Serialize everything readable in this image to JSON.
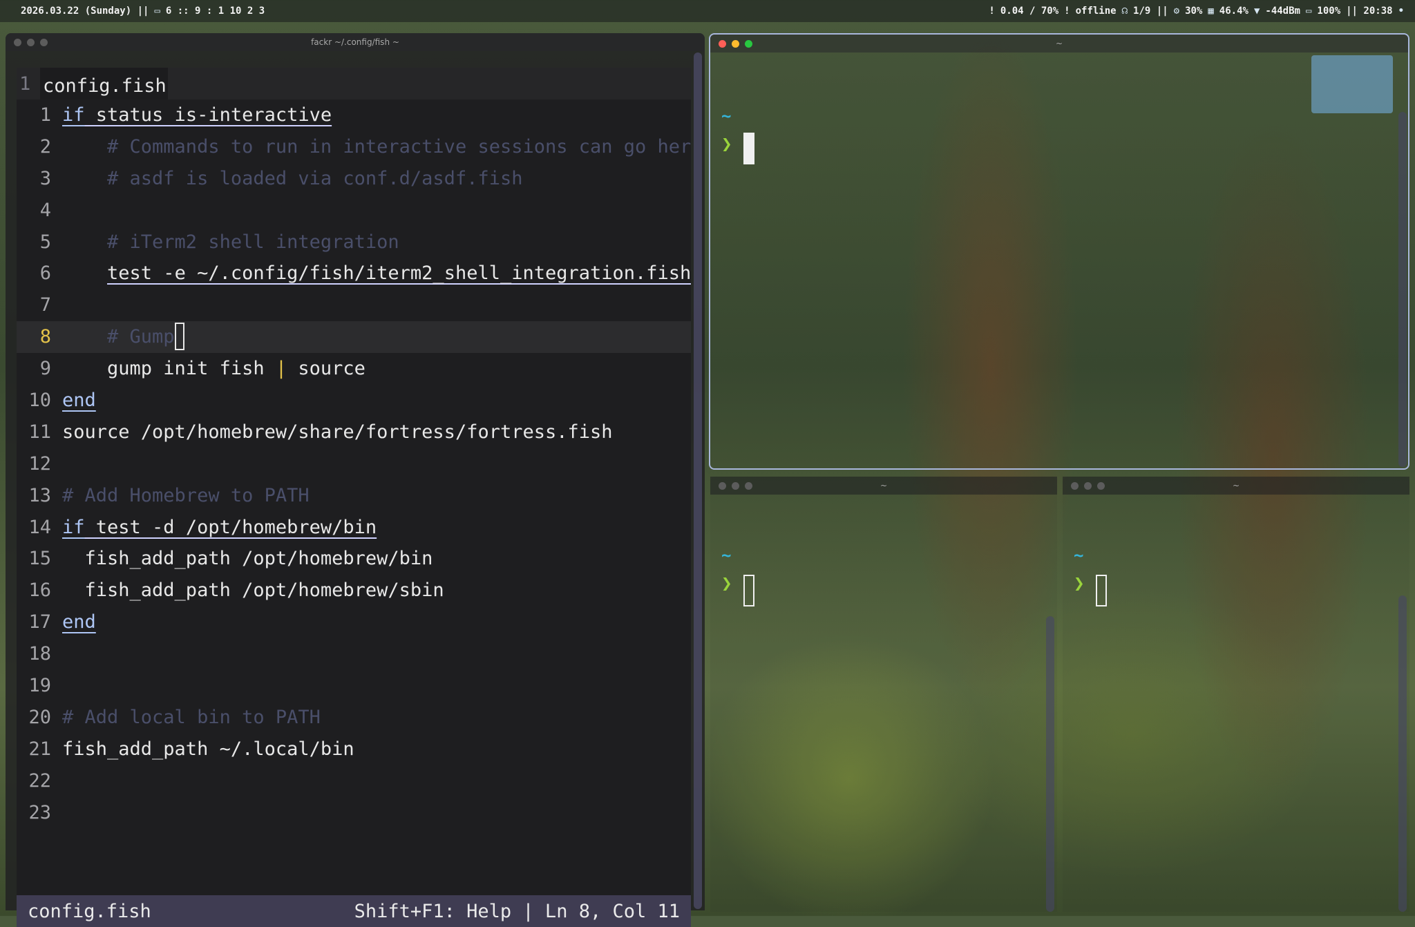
{
  "menubar": {
    "date": "2026.03.22 (Sunday) ||",
    "workspaces": "6 :: 9 : 1 10 2 3",
    "load": "0.04 / 70%",
    "net": "offline",
    "vpn": "1/9 ||",
    "cpu": "30%",
    "mem": "46.4%",
    "wifi": "-44dBm",
    "battery": "100%",
    "clock": "|| 20:38"
  },
  "editor_window": {
    "title": "fackr ~/.config/fish ~",
    "tab_number": "1",
    "tab_name": "config.fish",
    "lines": [
      {
        "n": "1"
      },
      {
        "n": "2"
      },
      {
        "n": "3"
      },
      {
        "n": "4"
      },
      {
        "n": "5"
      },
      {
        "n": "6"
      },
      {
        "n": "7"
      },
      {
        "n": "8"
      },
      {
        "n": "9"
      },
      {
        "n": "10"
      },
      {
        "n": "11"
      },
      {
        "n": "12"
      },
      {
        "n": "13"
      },
      {
        "n": "14"
      },
      {
        "n": "15"
      },
      {
        "n": "16"
      },
      {
        "n": "17"
      },
      {
        "n": "18"
      },
      {
        "n": "19"
      },
      {
        "n": "20"
      },
      {
        "n": "21"
      },
      {
        "n": "22"
      },
      {
        "n": "23"
      }
    ],
    "code": {
      "l1_kw": "if",
      "l1_rest": " status is-interactive",
      "l2": "    # Commands to run in interactive sessions can go here",
      "l3": "    # asdf is loaded via conf.d/asdf.fish",
      "l5": "    # iTerm2 shell integration",
      "l6_indent": "    ",
      "l6": "test -e ~/.config/fish/iterm2_shell_integration.fish",
      "l8_indent": "    ",
      "l8": "# Gump",
      "l9_a": "    gump init fish ",
      "l9_pipe": "|",
      "l9_b": " source",
      "l10": "end",
      "l11": "source /opt/homebrew/share/fortress/fortress.fish",
      "l13": "# Add Homebrew to PATH",
      "l14_kw": "if",
      "l14_rest": " test -d /opt/homebrew/bin",
      "l15": "  fish_add_path /opt/homebrew/bin",
      "l16": "  fish_add_path /opt/homebrew/sbin",
      "l17": "end",
      "l20": "# Add local bin to PATH",
      "l21": "fish_add_path ~/.local/bin"
    },
    "status_file": "config.fish",
    "status_info": "Shift+F1: Help | Ln 8, Col 11"
  },
  "terminals": {
    "main_title": "~",
    "bottom_left_title": "~",
    "bottom_right_title": "~",
    "prompt_dir": "~",
    "prompt_symbol": "❯"
  },
  "colors": {
    "keyword": "#aec6f5",
    "comment": "#4a4f6a",
    "current_line_number": "#e3c24a",
    "statusline_bg": "#3f3c52",
    "prompt_dir": "#35b4d8",
    "prompt_symbol": "#9ad43c",
    "active_border": "#a9b7dc"
  },
  "icons": [
    "display-icon",
    "alert-icon",
    "vpn-icon",
    "cpu-icon",
    "memory-icon",
    "wifi-icon",
    "battery-icon",
    "dot-icon"
  ]
}
